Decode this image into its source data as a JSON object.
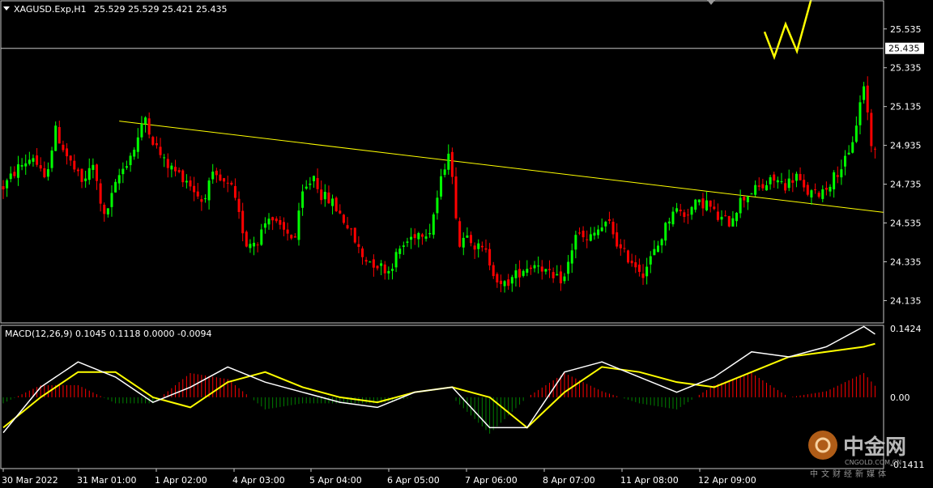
{
  "chart_data": [
    {
      "type": "candlestick",
      "title": "XAGUSD.Exp,H1",
      "ohlc_label": "25.529 25.529 25.421 25.435",
      "current_price_label": "25.435",
      "current_price": 25.435,
      "ylim": [
        24.02,
        25.68
      ],
      "y_ticks": [
        25.535,
        25.335,
        25.135,
        24.935,
        24.735,
        24.535,
        24.335,
        24.135
      ],
      "x_tick_labels": [
        "30 Mar 2022",
        "31 Mar 01:00",
        "1 Apr 02:00",
        "4 Apr 03:00",
        "5 Apr 04:00",
        "6 Apr 05:00",
        "7 Apr 06:00",
        "8 Apr 07:00",
        "11 Apr 08:00",
        "12 Apr 09:00"
      ],
      "candle_count": 199,
      "trendline": {
        "from_price": 25.06,
        "to_price": 24.59
      },
      "projection_arrow": {
        "prices": [
          25.52,
          25.39,
          25.56,
          25.42,
          25.71
        ],
        "color": "#ffff00"
      },
      "colors": {
        "up": "#00ff00",
        "down": "#ff0000",
        "trendline": "#ffff00",
        "grid": "#c8c8c8"
      },
      "path": [
        [
          0,
          24.72
        ],
        [
          4,
          24.82
        ],
        [
          8,
          24.88
        ],
        [
          11,
          24.75
        ],
        [
          14,
          25.01
        ],
        [
          17,
          24.88
        ],
        [
          21,
          24.74
        ],
        [
          24,
          24.83
        ],
        [
          27,
          24.56
        ],
        [
          31,
          24.78
        ],
        [
          35,
          24.92
        ],
        [
          38,
          25.08
        ],
        [
          40,
          24.96
        ],
        [
          43,
          24.85
        ],
        [
          46,
          24.8
        ],
        [
          49,
          24.76
        ],
        [
          53,
          24.65
        ],
        [
          56,
          24.77
        ],
        [
          61,
          24.71
        ],
        [
          65,
          24.43
        ],
        [
          68,
          24.45
        ],
        [
          71,
          24.58
        ],
        [
          74,
          24.5
        ],
        [
          78,
          24.46
        ],
        [
          80,
          24.68
        ],
        [
          83,
          24.78
        ],
        [
          85,
          24.68
        ],
        [
          88,
          24.64
        ],
        [
          92,
          24.52
        ],
        [
          96,
          24.36
        ],
        [
          99,
          24.33
        ],
        [
          103,
          24.29
        ],
        [
          106,
          24.4
        ],
        [
          110,
          24.48
        ],
        [
          114,
          24.5
        ],
        [
          117,
          24.75
        ],
        [
          119,
          24.92
        ],
        [
          122,
          24.42
        ],
        [
          124,
          24.5
        ],
        [
          126,
          24.42
        ],
        [
          129,
          24.38
        ],
        [
          133,
          24.2
        ],
        [
          136,
          24.25
        ],
        [
          139,
          24.3
        ],
        [
          143,
          24.33
        ],
        [
          147,
          24.24
        ],
        [
          150,
          24.25
        ],
        [
          153,
          24.48
        ],
        [
          156,
          24.44
        ],
        [
          159,
          24.5
        ],
        [
          162,
          24.53
        ],
        [
          165,
          24.39
        ],
        [
          168,
          24.34
        ],
        [
          171,
          24.28
        ],
        [
          175,
          24.42
        ],
        [
          179,
          24.61
        ],
        [
          182,
          24.58
        ],
        [
          185,
          24.63
        ],
        [
          188,
          24.64
        ],
        [
          191,
          24.56
        ],
        [
          194,
          24.54
        ],
        [
          197,
          24.65
        ],
        [
          200,
          24.7
        ],
        [
          203,
          24.72
        ],
        [
          206,
          24.76
        ],
        [
          209,
          24.73
        ],
        [
          212,
          24.78
        ],
        [
          214,
          24.7
        ],
        [
          217,
          24.68
        ],
        [
          220,
          24.72
        ],
        [
          223,
          24.8
        ],
        [
          226,
          24.88
        ],
        [
          228,
          25.05
        ],
        [
          230,
          25.25
        ],
        [
          232,
          24.95
        ],
        [
          235,
          24.8
        ],
        [
          238,
          24.93
        ],
        [
          241,
          24.98
        ],
        [
          243,
          25.0
        ],
        [
          245,
          25.1
        ],
        [
          248,
          25.05
        ],
        [
          250,
          24.9
        ],
        [
          253,
          25.0
        ],
        [
          255,
          25.35
        ],
        [
          257,
          25.55
        ],
        [
          260,
          25.4
        ],
        [
          263,
          25.38
        ],
        [
          266,
          25.35
        ],
        [
          269,
          25.45
        ],
        [
          272,
          25.52
        ],
        [
          275,
          25.43
        ]
      ]
    },
    {
      "type": "line",
      "title": "MACD(12,26,9) 0.1045 0.1118 0.0000 -0.0094",
      "ylim": [
        -0.1411,
        0.1424
      ],
      "y_ticks_labels": [
        "0.1424",
        "0.00",
        "-0.1411"
      ],
      "colors": {
        "macd": "#ffffff",
        "signal": "#ffff00",
        "hist_up": "#ff0000",
        "hist_down": "#008000"
      },
      "macd_path": [
        [
          0,
          -0.07
        ],
        [
          10,
          0.02
        ],
        [
          20,
          0.07
        ],
        [
          30,
          0.04
        ],
        [
          40,
          -0.01
        ],
        [
          50,
          0.02
        ],
        [
          60,
          0.06
        ],
        [
          70,
          0.03
        ],
        [
          80,
          0.01
        ],
        [
          90,
          -0.01
        ],
        [
          100,
          -0.02
        ],
        [
          110,
          0.01
        ],
        [
          120,
          0.02
        ],
        [
          130,
          -0.06
        ],
        [
          140,
          -0.06
        ],
        [
          150,
          0.05
        ],
        [
          160,
          0.07
        ],
        [
          170,
          0.04
        ],
        [
          180,
          0.01
        ],
        [
          190,
          0.04
        ],
        [
          200,
          0.09
        ],
        [
          210,
          0.08
        ],
        [
          220,
          0.1
        ],
        [
          230,
          0.14
        ],
        [
          240,
          0.09
        ],
        [
          250,
          0.1
        ],
        [
          260,
          0.14
        ],
        [
          270,
          0.12
        ],
        [
          275,
          0.11
        ]
      ],
      "signal_path": [
        [
          0,
          -0.06
        ],
        [
          10,
          0.0
        ],
        [
          20,
          0.05
        ],
        [
          30,
          0.05
        ],
        [
          40,
          0.0
        ],
        [
          50,
          -0.02
        ],
        [
          60,
          0.03
        ],
        [
          70,
          0.05
        ],
        [
          80,
          0.02
        ],
        [
          90,
          0.0
        ],
        [
          100,
          -0.01
        ],
        [
          110,
          0.01
        ],
        [
          120,
          0.02
        ],
        [
          130,
          0.0
        ],
        [
          140,
          -0.06
        ],
        [
          150,
          0.01
        ],
        [
          160,
          0.06
        ],
        [
          170,
          0.05
        ],
        [
          180,
          0.03
        ],
        [
          190,
          0.02
        ],
        [
          200,
          0.05
        ],
        [
          210,
          0.08
        ],
        [
          220,
          0.09
        ],
        [
          230,
          0.1
        ],
        [
          240,
          0.12
        ],
        [
          250,
          0.1
        ],
        [
          260,
          0.1
        ],
        [
          270,
          0.13
        ],
        [
          275,
          0.12
        ]
      ]
    }
  ],
  "watermark": {
    "brand": "中金网",
    "domain": "CNGOLD.COM.CN",
    "subtitle": "中文财经新媒体"
  }
}
